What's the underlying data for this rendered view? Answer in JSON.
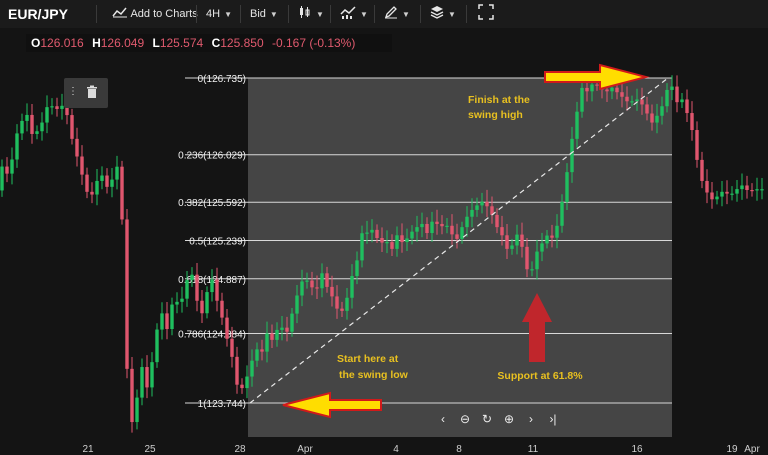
{
  "toolbar": {
    "symbol": "EUR/JPY",
    "add_to_charts": "Add to Charts",
    "timeframe": "4H",
    "price_side": "Bid",
    "icons": [
      "chart-add-icon",
      "candlestick-type-icon",
      "indicators-icon",
      "drawing-pen-icon",
      "layers-icon",
      "fullscreen-icon"
    ]
  },
  "ohlc": {
    "o_label": "O",
    "o": "126.016",
    "h_label": "H",
    "h": "126.049",
    "l_label": "L",
    "l": "125.574",
    "c_label": "C",
    "c": "125.850",
    "change": "-0.167 (-0.13%)"
  },
  "navigator": {
    "icons": [
      "scroll-left-icon",
      "zoom-out-icon",
      "reset-icon",
      "zoom-in-icon",
      "scroll-right-icon",
      "scroll-to-end-icon"
    ],
    "glyphs": [
      "‹",
      "⊖",
      "↻",
      "⊕",
      "›",
      "›|"
    ]
  },
  "colors": {
    "background": "#141414",
    "fib_shade": "#4a4a4a",
    "up_candle": "#1fbf5f",
    "down_candle": "#e0566e",
    "annotation_text": "#e8c020",
    "arrow_fill": "#ffdd00",
    "arrow_outline": "#d11a1a",
    "support_arrow": "#c0262c"
  },
  "chart_data": {
    "type": "candlestick",
    "symbol": "EUR/JPY",
    "timeframe": "4H",
    "x_tick_labels": [
      "21",
      "25",
      "28",
      "Apr",
      "4",
      "8",
      "11",
      "16",
      "19",
      "Apr"
    ],
    "fib_levels": [
      {
        "ratio": "0",
        "price": 126.735,
        "label": "0(126.735)"
      },
      {
        "ratio": "0.236",
        "price": 126.029,
        "label": "0.236(126.029)"
      },
      {
        "ratio": "0.382",
        "price": 125.592,
        "label": "0.382(125.592)"
      },
      {
        "ratio": "0.5",
        "price": 125.239,
        "label": "0.5(125.239)"
      },
      {
        "ratio": "0.618",
        "price": 124.887,
        "label": "0.618(124.887)"
      },
      {
        "ratio": "0.786",
        "price": 124.384,
        "label": "0.786(124.384)"
      },
      {
        "ratio": "1",
        "price": 123.744,
        "label": "1(123.744)"
      }
    ],
    "trend_line": {
      "from_price": 123.744,
      "to_price": 126.735
    },
    "annotations": {
      "finish": [
        "Finish at  the",
        "swing high"
      ],
      "start": [
        "Start here at",
        "the swing  low"
      ],
      "support": "Support at 61.8%"
    },
    "price_path": [
      [
        0,
        126.1
      ],
      [
        5,
        125.9
      ],
      [
        10,
        125.85
      ],
      [
        15,
        126.0
      ],
      [
        20,
        126.25
      ],
      [
        25,
        126.35
      ],
      [
        30,
        126.4
      ],
      [
        35,
        126.2
      ],
      [
        40,
        126.25
      ],
      [
        46,
        126.35
      ],
      [
        52,
        126.55
      ],
      [
        57,
        126.4
      ],
      [
        62,
        126.5
      ],
      [
        68,
        126.45
      ],
      [
        72,
        126.3
      ],
      [
        76,
        126.1
      ],
      [
        82,
        125.95
      ],
      [
        88,
        125.7
      ],
      [
        94,
        125.65
      ],
      [
        100,
        125.8
      ],
      [
        106,
        125.85
      ],
      [
        112,
        125.65
      ],
      [
        117,
        125.95
      ],
      [
        121,
        125.9
      ],
      [
        124,
        125.6
      ],
      [
        127,
        124.6
      ],
      [
        130,
        123.95
      ],
      [
        134,
        123.55
      ],
      [
        138,
        123.7
      ],
      [
        142,
        123.95
      ],
      [
        146,
        124.15
      ],
      [
        150,
        123.85
      ],
      [
        155,
        124.15
      ],
      [
        160,
        124.45
      ],
      [
        164,
        124.6
      ],
      [
        168,
        124.35
      ],
      [
        172,
        124.55
      ],
      [
        177,
        124.75
      ],
      [
        182,
        124.6
      ],
      [
        188,
        124.85
      ],
      [
        194,
        124.95
      ],
      [
        199,
        124.7
      ],
      [
        204,
        124.55
      ],
      [
        209,
        124.75
      ],
      [
        214,
        124.9
      ],
      [
        219,
        124.7
      ],
      [
        224,
        124.55
      ],
      [
        229,
        124.35
      ],
      [
        234,
        124.2
      ],
      [
        238,
        123.95
      ],
      [
        242,
        123.85
      ],
      [
        246,
        123.9
      ],
      [
        252,
        124.05
      ],
      [
        258,
        124.25
      ],
      [
        264,
        124.2
      ],
      [
        270,
        124.4
      ],
      [
        276,
        124.3
      ],
      [
        282,
        124.5
      ],
      [
        288,
        124.35
      ],
      [
        294,
        124.55
      ],
      [
        300,
        124.75
      ],
      [
        306,
        124.9
      ],
      [
        312,
        124.85
      ],
      [
        318,
        124.75
      ],
      [
        324,
        124.95
      ],
      [
        330,
        124.8
      ],
      [
        336,
        124.7
      ],
      [
        342,
        124.55
      ],
      [
        348,
        124.65
      ],
      [
        354,
        124.9
      ],
      [
        358,
        125.0
      ],
      [
        362,
        125.15
      ],
      [
        366,
        125.4
      ],
      [
        370,
        125.3
      ],
      [
        376,
        125.35
      ],
      [
        382,
        125.2
      ],
      [
        388,
        125.25
      ],
      [
        394,
        125.15
      ],
      [
        400,
        125.3
      ],
      [
        406,
        125.2
      ],
      [
        412,
        125.3
      ],
      [
        418,
        125.35
      ],
      [
        424,
        125.4
      ],
      [
        430,
        125.3
      ],
      [
        436,
        125.45
      ],
      [
        442,
        125.35
      ],
      [
        448,
        125.4
      ],
      [
        454,
        125.3
      ],
      [
        460,
        125.25
      ],
      [
        466,
        125.4
      ],
      [
        472,
        125.5
      ],
      [
        478,
        125.55
      ],
      [
        484,
        125.6
      ],
      [
        490,
        125.55
      ],
      [
        496,
        125.45
      ],
      [
        500,
        125.35
      ],
      [
        504,
        125.3
      ],
      [
        508,
        125.2
      ],
      [
        512,
        125.1
      ],
      [
        516,
        125.25
      ],
      [
        520,
        125.3
      ],
      [
        524,
        125.2
      ],
      [
        528,
        125.05
      ],
      [
        532,
        124.85
      ],
      [
        536,
        125.05
      ],
      [
        540,
        125.15
      ],
      [
        544,
        125.2
      ],
      [
        548,
        125.3
      ],
      [
        553,
        125.25
      ],
      [
        558,
        125.3
      ],
      [
        562,
        125.5
      ],
      [
        566,
        125.65
      ],
      [
        570,
        125.9
      ],
      [
        574,
        126.15
      ],
      [
        578,
        126.35
      ],
      [
        582,
        126.55
      ],
      [
        586,
        126.7
      ],
      [
        590,
        126.6
      ],
      [
        596,
        126.7
      ],
      [
        602,
        126.65
      ],
      [
        608,
        126.6
      ],
      [
        614,
        126.65
      ],
      [
        620,
        126.6
      ],
      [
        626,
        126.55
      ],
      [
        632,
        126.5
      ],
      [
        638,
        126.55
      ],
      [
        644,
        126.5
      ],
      [
        650,
        126.4
      ],
      [
        656,
        126.3
      ],
      [
        662,
        126.45
      ],
      [
        667,
        126.5
      ],
      [
        672,
        126.75
      ],
      [
        676,
        126.6
      ],
      [
        680,
        126.5
      ],
      [
        684,
        126.55
      ],
      [
        688,
        126.45
      ],
      [
        692,
        126.35
      ],
      [
        696,
        126.2
      ],
      [
        700,
        125.95
      ],
      [
        704,
        125.8
      ],
      [
        708,
        125.7
      ],
      [
        712,
        125.65
      ],
      [
        716,
        125.6
      ],
      [
        720,
        125.65
      ],
      [
        726,
        125.7
      ],
      [
        732,
        125.65
      ],
      [
        738,
        125.7
      ],
      [
        744,
        125.75
      ],
      [
        750,
        125.7
      ],
      [
        756,
        125.7
      ],
      [
        762,
        125.72
      ],
      [
        768,
        125.7
      ]
    ]
  }
}
